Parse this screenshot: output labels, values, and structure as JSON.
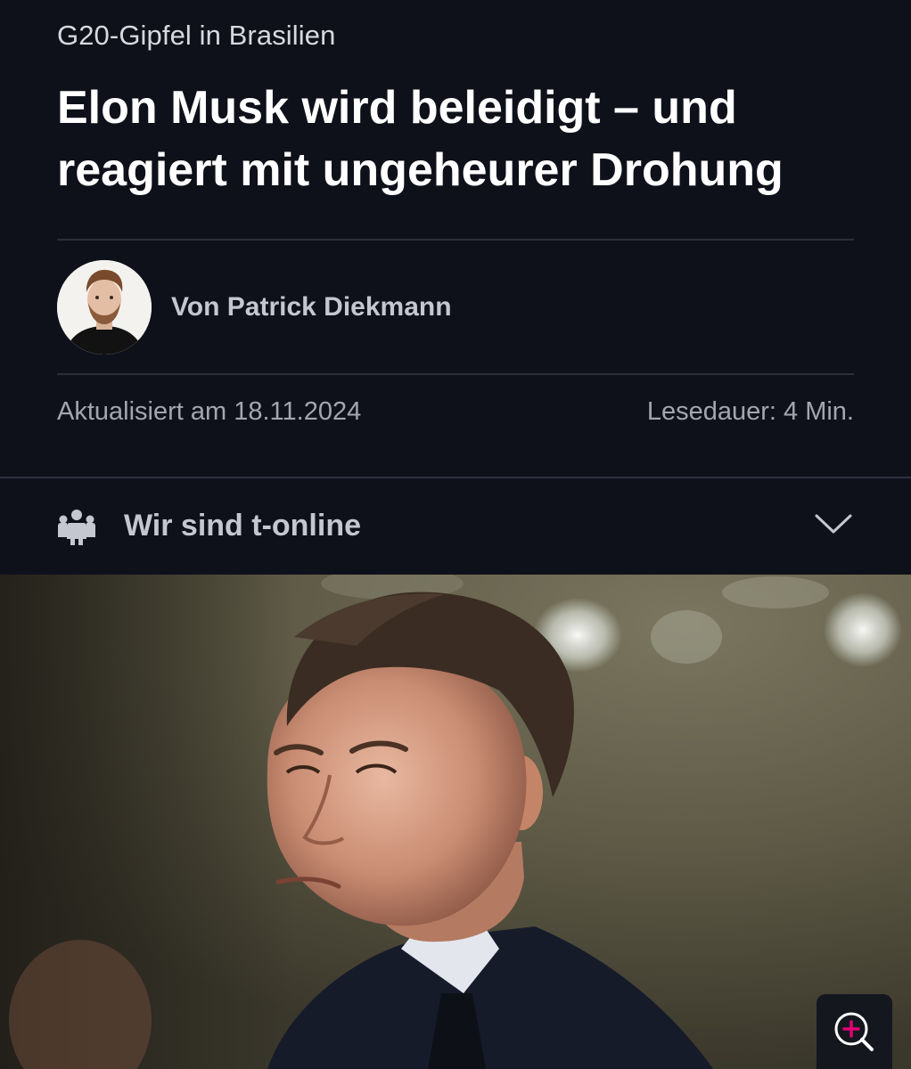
{
  "article": {
    "kicker": "G20-Gipfel in Brasilien",
    "headline": "Elon Musk wird beleidigt – und reagiert mit ungeheurer Drohung",
    "author": "Von Patrick Diekmann",
    "updated": "Aktualisiert am 18.11.2024",
    "read_time": "Lesedauer: 4 Min."
  },
  "section": {
    "label": "Wir sind t-online",
    "icon": "people-group-icon",
    "toggle_icon": "chevron-down-icon"
  },
  "hero": {
    "zoom_icon": "zoom-in-icon"
  },
  "colors": {
    "background": "#0f111a",
    "accent": "#e20074",
    "text_primary": "#ffffff",
    "text_secondary": "#a3a6b0"
  }
}
